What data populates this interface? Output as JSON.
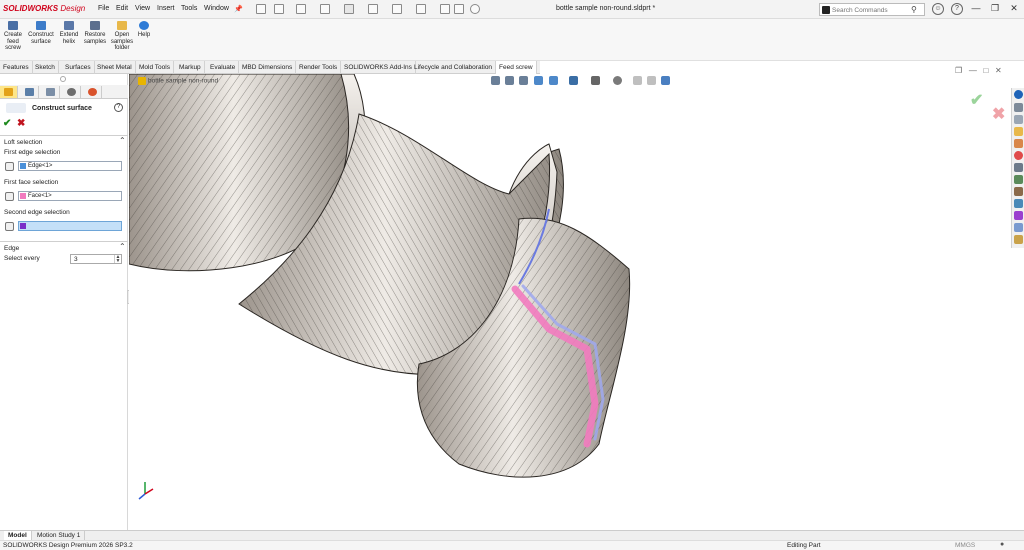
{
  "app": {
    "logo_brand": "SOLIDWORKS",
    "logo_product": "Design",
    "document_title": "bottle sample non-round.sldprt *"
  },
  "menu": [
    "File",
    "Edit",
    "View",
    "Insert",
    "Tools",
    "Window"
  ],
  "search": {
    "placeholder": "Search Commands"
  },
  "command_manager": [
    {
      "label": "Create feed screw",
      "icon": "feed-screw-icon"
    },
    {
      "label": "Construct surface",
      "icon": "construct-surface-icon"
    },
    {
      "label": "Extend helix",
      "icon": "extend-helix-icon"
    },
    {
      "label": "Restore samples",
      "icon": "restore-samples-icon"
    },
    {
      "label": "Open samples folder",
      "icon": "folder-icon"
    },
    {
      "label": "Help",
      "icon": "help-icon"
    }
  ],
  "tabs": [
    "Features",
    "Sketch",
    "Surfaces",
    "Sheet Metal",
    "Mold Tools",
    "Markup",
    "Evaluate",
    "MBD Dimensions",
    "Render Tools",
    "SOLIDWORKS Add-Ins",
    "Lifecycle and Collaboration",
    "Feed screw"
  ],
  "active_tab": "Feed screw",
  "property_manager": {
    "title": "Construct surface",
    "loft_section": "Loft selection",
    "first_edge_label": "First edge selection",
    "first_edge_value": "Edge<1>",
    "first_face_label": "First face selection",
    "first_face_value": "Face<1>",
    "second_edge_label": "Second edge selection",
    "second_edge_value": "",
    "edge_section": "Edge",
    "select_every_label": "Select every",
    "select_every_value": "3"
  },
  "tree_flyout": "bottle sample non-round",
  "bottom_tabs": [
    "Model",
    "Motion Study 1"
  ],
  "status": {
    "product": "SOLIDWORKS Design Premium 2026 SP3.2",
    "mode": "Editing Part",
    "units": "MMGS"
  },
  "colors": {
    "accent_blue": "#4a90d9",
    "brand_red": "#d0021b",
    "selection_pink": "#f27bbf",
    "selection_purple": "#7a2fc8"
  }
}
